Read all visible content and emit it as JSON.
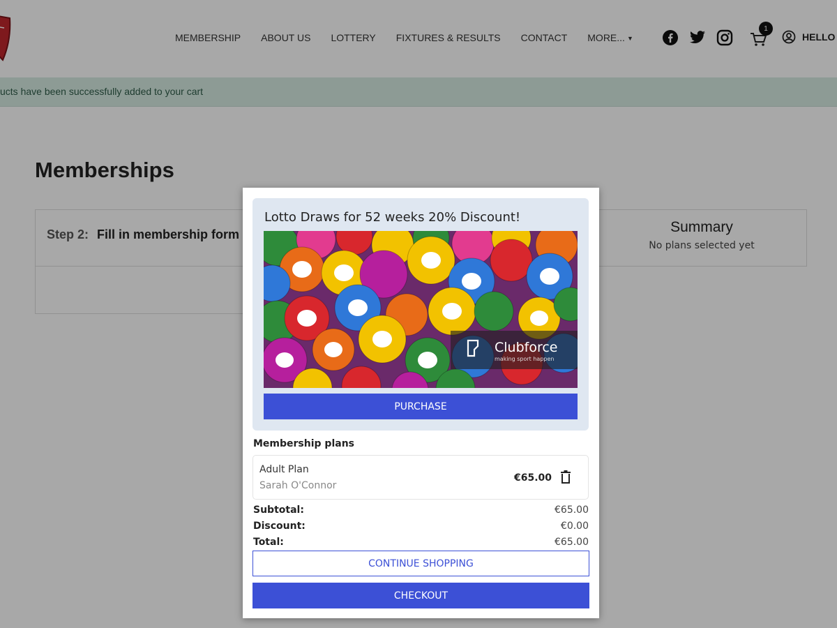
{
  "colors": {
    "accent": "#3c50d6",
    "alert_bg": "#d7ebe3",
    "alert_text": "#2f5d4a",
    "crest_red": "#c0262d"
  },
  "header": {
    "nav": [
      {
        "label": "MEMBERSHIP"
      },
      {
        "label": "ABOUT US"
      },
      {
        "label": "LOTTERY"
      },
      {
        "label": "FIXTURES & RESULTS"
      },
      {
        "label": "CONTACT"
      },
      {
        "label": "MORE..."
      }
    ],
    "social_icons": [
      "facebook-icon",
      "twitter-icon",
      "instagram-icon"
    ],
    "cart_count": "1",
    "user_label": "HELLO"
  },
  "alert": {
    "text": "ucts have been successfully added to your cart"
  },
  "page": {
    "title": "Memberships",
    "step_label": "Step 2:",
    "step_title": "Fill in membership form",
    "summary_title": "Summary",
    "summary_sub": "No plans selected yet"
  },
  "modal": {
    "promo": {
      "title": "Lotto Draws for 52 weeks 20% Discount!",
      "brand": "Clubforce",
      "tagline": "making sport happen",
      "button": "PURCHASE"
    },
    "plans_label": "Membership plans",
    "plan": {
      "name": "Adult Plan",
      "person": "Sarah O'Connor",
      "price": "€65.00"
    },
    "totals": [
      {
        "label": "Subtotal:",
        "value": "€65.00"
      },
      {
        "label": "Discount:",
        "value": "€0.00"
      },
      {
        "label": "Total:",
        "value": "€65.00"
      }
    ],
    "continue_button": "CONTINUE SHOPPING",
    "checkout_button": "CHECKOUT"
  }
}
